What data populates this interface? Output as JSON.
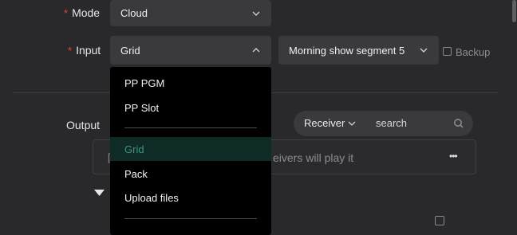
{
  "form": {
    "mode_label": "Mode",
    "mode_value": "Cloud",
    "input_label": "Input",
    "input_value": "Grid",
    "segment_value": "Morning show segment 5",
    "backup_label": "Backup",
    "output_label": "Output"
  },
  "output": {
    "receiver_label": "Receiver",
    "search_placeholder": "search",
    "message_left": "[",
    "message_visible": "eivers will play it",
    "more_label": "•••"
  },
  "dropdown": {
    "items": [
      {
        "label": "PP PGM"
      },
      {
        "label": "PP Slot"
      },
      {
        "label": "Grid",
        "selected": true
      },
      {
        "label": "Pack"
      },
      {
        "label": "Upload files"
      }
    ]
  },
  "colors": {
    "background": "#29292b",
    "field": "#3a3a3d",
    "required": "#e0463a",
    "selected_text": "#2f9a7f",
    "selected_bg": "#0e2b26"
  }
}
